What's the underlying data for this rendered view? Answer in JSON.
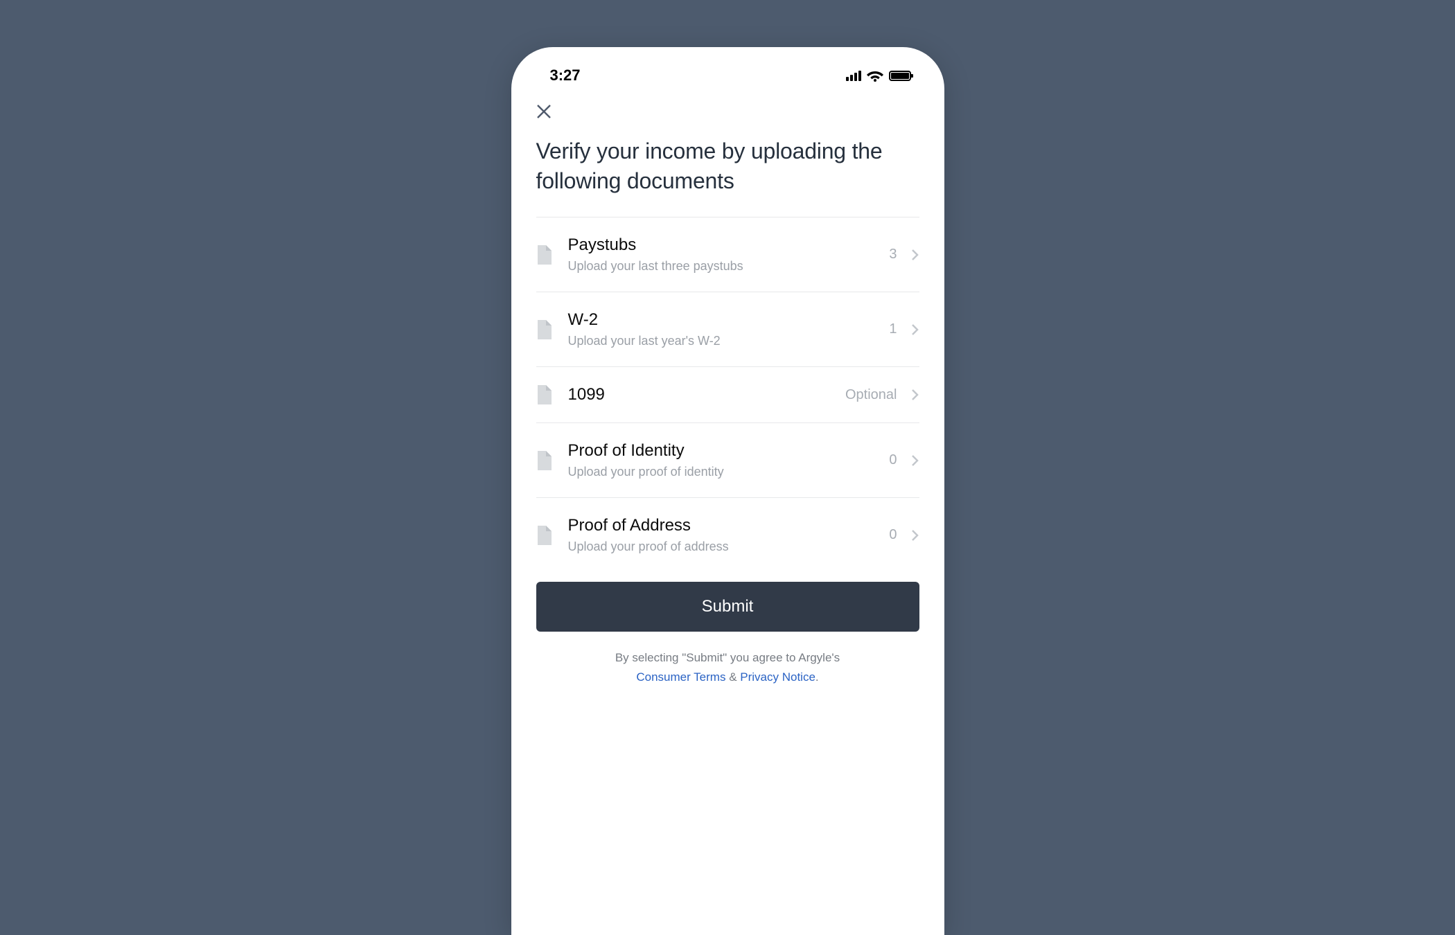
{
  "status_bar": {
    "time": "3:27"
  },
  "header": {
    "title": "Verify your income by uploading the following documents"
  },
  "documents": [
    {
      "title": "Paystubs",
      "subtitle": "Upload your last three paystubs",
      "meta": "3"
    },
    {
      "title": "W-2",
      "subtitle": "Upload your last year's W-2",
      "meta": "1"
    },
    {
      "title": "1099",
      "subtitle": "",
      "meta": "Optional"
    },
    {
      "title": "Proof of Identity",
      "subtitle": "Upload your proof of identity",
      "meta": "0"
    },
    {
      "title": "Proof of Address",
      "subtitle": "Upload your proof of address",
      "meta": "0"
    }
  ],
  "actions": {
    "submit_label": "Submit"
  },
  "legal": {
    "prefix": "By selecting \"Submit\" you agree to Argyle's",
    "link1": "Consumer Terms",
    "amp": " & ",
    "link2": "Privacy Notice",
    "suffix": "."
  }
}
